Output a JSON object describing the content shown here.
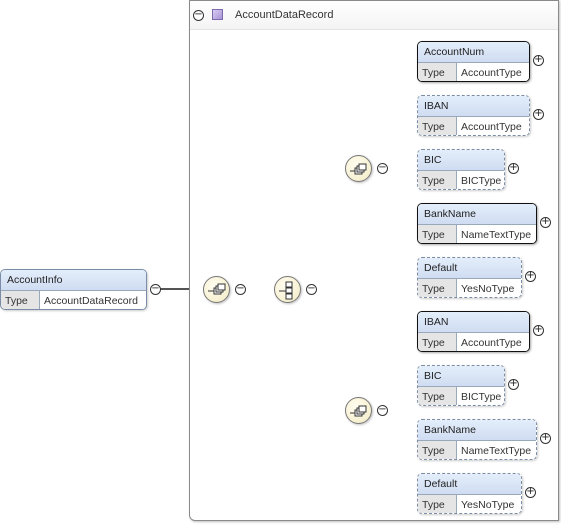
{
  "root": {
    "name": "AccountInfo",
    "type_label": "Type",
    "type_value": "AccountDataRecord"
  },
  "complex_type": {
    "title": "AccountDataRecord"
  },
  "choice_1": [
    {
      "name": "AccountNum",
      "type_label": "Type",
      "type_value": "AccountType",
      "occurrence": "required"
    },
    {
      "name": "IBAN",
      "type_label": "Type",
      "type_value": "AccountType",
      "occurrence": "optional"
    },
    {
      "name": "BIC",
      "type_label": "Type",
      "type_value": "BICType",
      "occurrence": "optional"
    },
    {
      "name": "BankName",
      "type_label": "Type",
      "type_value": "NameTextType",
      "occurrence": "required"
    },
    {
      "name": "Default",
      "type_label": "Type",
      "type_value": "YesNoType",
      "occurrence": "optional"
    }
  ],
  "choice_2": [
    {
      "name": "IBAN",
      "type_label": "Type",
      "type_value": "AccountType",
      "occurrence": "required"
    },
    {
      "name": "BIC",
      "type_label": "Type",
      "type_value": "BICType",
      "occurrence": "optional"
    },
    {
      "name": "BankName",
      "type_label": "Type",
      "type_value": "NameTextType",
      "occurrence": "optional"
    },
    {
      "name": "Default",
      "type_label": "Type",
      "type_value": "YesNoType",
      "occurrence": "optional"
    }
  ],
  "toggles": {
    "expanded": "−",
    "collapsed": "+"
  }
}
